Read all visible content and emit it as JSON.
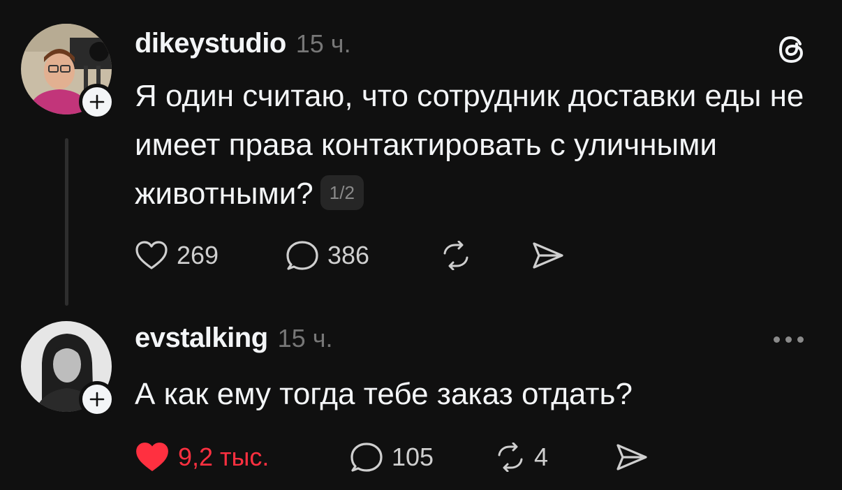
{
  "posts": [
    {
      "username": "dikeystudio",
      "time": "15 ч.",
      "text": "Я один считаю, что сотрудник доставки еды не имеет права контактировать с уличными животными?",
      "page_indicator": "1/2",
      "likes": "269",
      "replies": "386",
      "liked": false
    },
    {
      "username": "evstalking",
      "time": "15 ч.",
      "text": "А как ему тогда тебе заказ отдать?",
      "likes": "9,2 тыс.",
      "replies": "105",
      "reposts": "4",
      "liked": true
    }
  ],
  "icons": {
    "threads_logo": "threads-logo-icon",
    "heart": "heart-icon",
    "reply": "reply-bubble-icon",
    "repost": "repost-icon",
    "share": "send-icon",
    "more": "more-dots-icon",
    "follow": "plus-icon"
  },
  "colors": {
    "background": "#101010",
    "text": "#f3f5f7",
    "muted": "#777777",
    "like_red": "#ff3040"
  }
}
